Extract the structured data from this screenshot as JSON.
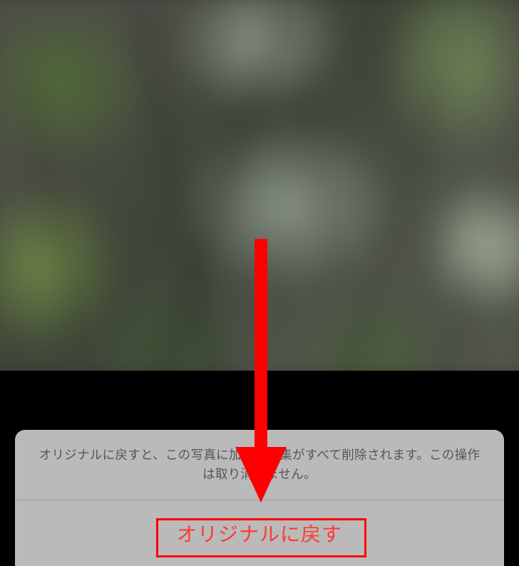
{
  "dialog": {
    "message": "オリジナルに戻すと、この写真に加えた編集がすべて削除されます。この操作は取り消せません。",
    "revert_button_label": "オリジナルに戻す"
  },
  "colors": {
    "destructive": "#ff3b30",
    "annotation": "#ff0000"
  }
}
